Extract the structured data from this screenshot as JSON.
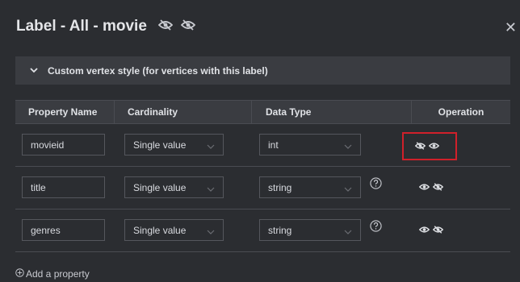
{
  "dialog": {
    "title": "Label - All - movie",
    "close_icon": "close-icon",
    "title_icons": [
      "eye-off-icon",
      "eye-off-icon"
    ]
  },
  "collapse": {
    "label": "Custom vertex style (for vertices with this label)",
    "icon": "chevron-down-icon"
  },
  "table": {
    "headers": [
      "Property Name",
      "Cardinality",
      "Data Type",
      "Operation"
    ],
    "rows": [
      {
        "name": "movieid",
        "cardinality": "Single value",
        "type": "int",
        "has_help": false,
        "ops": [
          "eye-off-icon",
          "eye-icon"
        ],
        "highlighted": true
      },
      {
        "name": "title",
        "cardinality": "Single value",
        "type": "string",
        "has_help": true,
        "ops": [
          "eye-icon",
          "eye-off-icon"
        ],
        "highlighted": false
      },
      {
        "name": "genres",
        "cardinality": "Single value",
        "type": "string",
        "has_help": true,
        "ops": [
          "eye-icon",
          "eye-off-icon"
        ],
        "highlighted": false
      }
    ]
  },
  "add_property": {
    "label": "Add a property",
    "icon": "plus-circle-icon"
  },
  "colors": {
    "background": "#2b2d31",
    "header_bg": "#3a3c41",
    "highlight_border": "#d0202a"
  }
}
